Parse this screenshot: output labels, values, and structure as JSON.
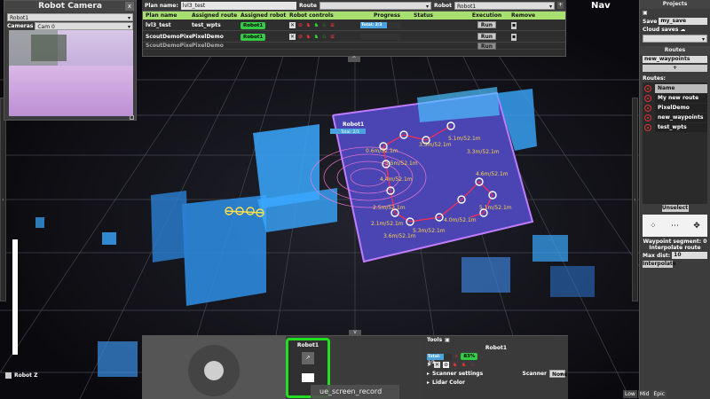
{
  "camera": {
    "title": "Robot Camera",
    "close_label": "x",
    "robot_select": "Robot1",
    "cameras_label": "Cameras",
    "camera_select": "Cam 0"
  },
  "topbar": {
    "plan_name_label": "Plan name:",
    "plan_name_value": "lvl3_test",
    "route_label": "Route",
    "robot_label": "Robot",
    "robot_value": "Robot1",
    "add_label": "+"
  },
  "plan_table": {
    "headers": [
      "Plan name",
      "Assigned route",
      "Assigned robot",
      "Robot controls",
      "Progress",
      "Status",
      "Execution",
      "Remove"
    ],
    "rows": [
      {
        "plan": "lvl3_test",
        "route": "test_wpts",
        "robot": "Robot1",
        "progress": "Total: 2/3",
        "progress_frac": 0.67,
        "run": "Run"
      },
      {
        "plan": "ScoutDemoPixelLvl1",
        "route": "PixelDemo",
        "robot": "Robot1",
        "progress": "",
        "progress_frac": 0,
        "run": "Run"
      },
      {
        "plan": "ScoutDemoPixelLvl1",
        "route": "PixelDemo",
        "robot": "",
        "progress": "",
        "progress_frac": 0,
        "run": "Run"
      }
    ]
  },
  "nav_label": "Nav",
  "projects": {
    "title": "Projects",
    "save_label": "Save",
    "save_value": "my_save",
    "cloud_label": "Cloud saves",
    "routes_title": "Routes",
    "routes_input": "new_waypoints",
    "routes_list_label": "Routes:",
    "route_items": [
      "Name",
      "My new route",
      "PixelDemo",
      "new_waypoints",
      "test_wpts"
    ],
    "selected_index": 0,
    "unselect_label": "Unselect",
    "waypoint_segment": "Waypoint segment: 0",
    "interpolate_route": "Interpolate route",
    "max_dist_label": "Max dist:",
    "max_dist_value": "10",
    "interpolate_button": "Interpolate"
  },
  "map": {
    "robot_label": "Robot1",
    "robot_progress": "Total: 2/3",
    "segment_labels": [
      "5.1m/52.1m",
      "3.5m/52.1m",
      "3.3m/52.1m",
      "3.5m/52.1m",
      "0.6m/52.1m",
      "4.4m/52.1m",
      "4.6m/52.1m",
      "2.5m/52.1m",
      "2.1m/52.1m",
      "5.3m/52.1m",
      "3.6m/52.1m",
      "4.0m/52.1m",
      "5.1m/52.1m"
    ]
  },
  "bottom": {
    "robot_card_name": "Robot1",
    "tools_label": "Tools",
    "tools_robot": "Robot1",
    "tools_progress": "Total: 2/3",
    "battery": "83%",
    "scanner_settings": "Scanner settings",
    "scanner_label": "Scanner",
    "scanner_value": "None",
    "lidar_color": "Lidar Color"
  },
  "screen_record": "ue_screen_record",
  "quality": [
    "Low",
    "Mid",
    "Epic"
  ],
  "robot_z_label": "Robot Z",
  "colors": {
    "accent_green": "#33cc44",
    "header_green": "#a8e070",
    "point_cloud_blue": "#3aa8ff",
    "point_cloud_purple": "#8f5cff",
    "route_yellow": "#ffd34a"
  }
}
